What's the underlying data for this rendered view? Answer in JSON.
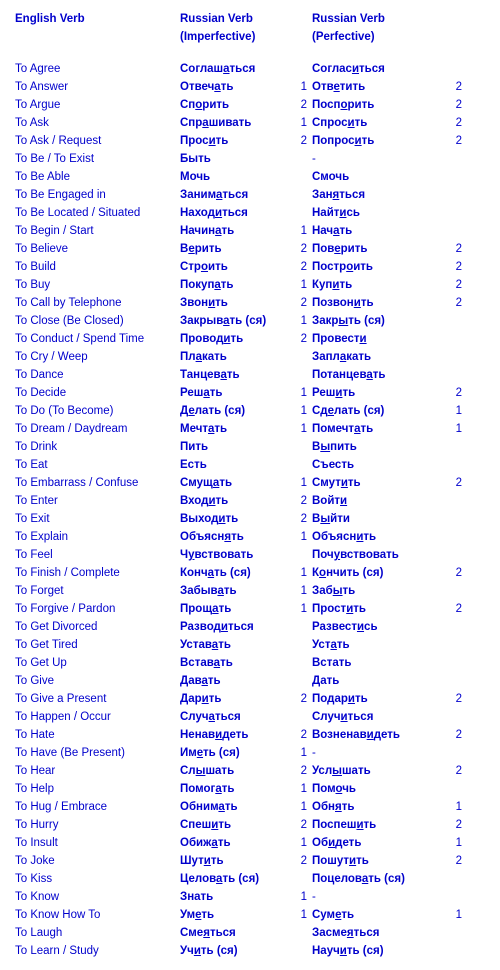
{
  "headers": {
    "english": "English Verb",
    "imperfective_line1": "Russian Verb",
    "imperfective_line2": "(Imperfective)",
    "perfective_line1": "Russian Verb",
    "perfective_line2": "(Perfective)"
  },
  "rows": [
    {
      "en": "To Agree",
      "imp": "Соглаш<u>а</u>ться",
      "impn": "",
      "perf": "Соглас<u>и</u>ться",
      "perfn": ""
    },
    {
      "en": "To Answer",
      "imp": "Отвеч<u>а</u>ть",
      "impn": "1",
      "perf": "Отв<u>е</u>тить",
      "perfn": "2"
    },
    {
      "en": "To Argue",
      "imp": "Сп<u>о</u>рить",
      "impn": "2",
      "perf": "Посп<u>о</u>рить",
      "perfn": "2"
    },
    {
      "en": "To Ask",
      "imp": "Спр<u>а</u>шивать",
      "impn": "1",
      "perf": "Спрос<u>и</u>ть",
      "perfn": "2"
    },
    {
      "en": "To Ask / Request",
      "imp": "Прос<u>и</u>ть",
      "impn": "2",
      "perf": "Попрос<u>и</u>ть",
      "perfn": "2"
    },
    {
      "en": "To Be / To Exist",
      "imp": "Быть",
      "impn": "",
      "perf": "-",
      "perfn": ""
    },
    {
      "en": "To Be Able",
      "imp": "Мочь",
      "impn": "",
      "perf": "Смочь",
      "perfn": ""
    },
    {
      "en": "To Be Engaged in",
      "imp": "Заним<u>а</u>ться",
      "impn": "",
      "perf": "Зан<u>я</u>ться",
      "perfn": ""
    },
    {
      "en": "To Be Located / Situated",
      "imp": "Наход<u>и</u>ться",
      "impn": "",
      "perf": "Найт<u>и</u>сь",
      "perfn": ""
    },
    {
      "en": "To Begin / Start",
      "imp": "Начин<u>а</u>ть",
      "impn": "1",
      "perf": "Нач<u>а</u>ть",
      "perfn": ""
    },
    {
      "en": "To Believe",
      "imp": "В<u>е</u>рить",
      "impn": "2",
      "perf": "Пов<u>е</u>рить",
      "perfn": "2"
    },
    {
      "en": "To Build",
      "imp": "Стр<u>о</u>ить",
      "impn": "2",
      "perf": "Постр<u>о</u>ить",
      "perfn": "2"
    },
    {
      "en": "To Buy",
      "imp": "Покуп<u>а</u>ть",
      "impn": "1",
      "perf": "Куп<u>и</u>ть",
      "perfn": "2"
    },
    {
      "en": "To Call by Telephone",
      "imp": "Звон<u>и</u>ть",
      "impn": "2",
      "perf": "Позвон<u>и</u>ть",
      "perfn": "2"
    },
    {
      "en": "To Close (Be Closed)",
      "imp": "Закрыв<u>а</u>ть (ся)",
      "impn": "1",
      "perf": "Закр<u>ы</u>ть (ся)",
      "perfn": ""
    },
    {
      "en": "To Conduct / Spend Time",
      "imp": "Провод<u>и</u>ть",
      "impn": "2",
      "perf": "Провест<u>и</u>",
      "perfn": ""
    },
    {
      "en": "To Cry / Weep",
      "imp": "Пл<u>а</u>кать",
      "impn": "",
      "perf": "Запл<u>а</u>кать",
      "perfn": ""
    },
    {
      "en": "To Dance",
      "imp": "Танцев<u>а</u>ть",
      "impn": "",
      "perf": "Потанцев<u>а</u>ть",
      "perfn": ""
    },
    {
      "en": "To Decide",
      "imp": "Реш<u>а</u>ть",
      "impn": "1",
      "perf": "Реш<u>и</u>ть",
      "perfn": "2"
    },
    {
      "en": "To Do (To Become)",
      "imp": "Д<u>е</u>лать (ся)",
      "impn": "1",
      "perf": "Сд<u>е</u>лать (ся)",
      "perfn": "1"
    },
    {
      "en": "To Dream / Daydream",
      "imp": "Мечт<u>а</u>ть",
      "impn": "1",
      "perf": "Помечт<u>а</u>ть",
      "perfn": "1"
    },
    {
      "en": "To Drink",
      "imp": "Пить",
      "impn": "",
      "perf": "В<u>ы</u>пить",
      "perfn": ""
    },
    {
      "en": "To Eat",
      "imp": "Есть",
      "impn": "",
      "perf": "Съесть",
      "perfn": ""
    },
    {
      "en": "To Embarrass / Confuse",
      "imp": "Смущ<u>а</u>ть",
      "impn": "1",
      "perf": "Смут<u>и</u>ть",
      "perfn": "2"
    },
    {
      "en": "To Enter",
      "imp": "Вход<u>и</u>ть",
      "impn": "2",
      "perf": "Войт<u>и</u>",
      "perfn": ""
    },
    {
      "en": "To Exit",
      "imp": "Выход<u>и</u>ть",
      "impn": "2",
      "perf": "В<u>ы</u>йти",
      "perfn": ""
    },
    {
      "en": "To Explain",
      "imp": "Объясн<u>я</u>ть",
      "impn": "1",
      "perf": "Объясн<u>и</u>ть",
      "perfn": ""
    },
    {
      "en": "To Feel",
      "imp": "Ч<u>у</u>вствовать",
      "impn": "",
      "perf": "Поч<u>у</u>вствовать",
      "perfn": ""
    },
    {
      "en": "To Finish / Complete",
      "imp": "Конч<u>а</u>ть (ся)",
      "impn": "1",
      "perf": "К<u>о</u>нчить (ся)",
      "perfn": "2"
    },
    {
      "en": "To Forget",
      "imp": "Забыв<u>а</u>ть",
      "impn": "1",
      "perf": "Заб<u>ы</u>ть",
      "perfn": ""
    },
    {
      "en": "To Forgive / Pardon",
      "imp": "Прощ<u>а</u>ть",
      "impn": "1",
      "perf": "Прост<u>и</u>ть",
      "perfn": "2"
    },
    {
      "en": "To Get Divorced",
      "imp": "Развод<u>и</u>ться",
      "impn": "",
      "perf": "Развест<u>и</u>сь",
      "perfn": ""
    },
    {
      "en": "To Get Tired",
      "imp": "Устав<u>а</u>ть",
      "impn": "",
      "perf": "Уст<u>а</u>ть",
      "perfn": ""
    },
    {
      "en": "To Get Up",
      "imp": "Встав<u>а</u>ть",
      "impn": "",
      "perf": "Встать",
      "perfn": ""
    },
    {
      "en": "To Give",
      "imp": "Дав<u>а</u>ть",
      "impn": "",
      "perf": "Дать",
      "perfn": ""
    },
    {
      "en": "To Give a Present",
      "imp": "Дар<u>и</u>ть",
      "impn": "2",
      "perf": "Подар<u>и</u>ть",
      "perfn": "2"
    },
    {
      "en": "To Happen / Occur",
      "imp": "Случ<u>а</u>ться",
      "impn": "",
      "perf": "Случ<u>и</u>ться",
      "perfn": ""
    },
    {
      "en": "To Hate",
      "imp": "Ненав<u>и</u>деть",
      "impn": "2",
      "perf": "Возненав<u>и</u>деть",
      "perfn": "2"
    },
    {
      "en": "To Have (Be Present)",
      "imp": "Им<u>е</u>ть (ся)",
      "impn": "1",
      "perf": "-",
      "perfn": ""
    },
    {
      "en": "To Hear",
      "imp": "Сл<u>ы</u>шать",
      "impn": "2",
      "perf": "Усл<u>ы</u>шать",
      "perfn": "2"
    },
    {
      "en": "To Help",
      "imp": "Помог<u>а</u>ть",
      "impn": "1",
      "perf": "Пом<u>о</u>чь",
      "perfn": ""
    },
    {
      "en": "To Hug / Embrace",
      "imp": "Обним<u>а</u>ть",
      "impn": "1",
      "perf": "Обн<u>я</u>ть",
      "perfn": "1"
    },
    {
      "en": "To Hurry",
      "imp": "Спеш<u>и</u>ть",
      "impn": "2",
      "perf": "Поспеш<u>и</u>ть",
      "perfn": "2"
    },
    {
      "en": "To Insult",
      "imp": "Обиж<u>а</u>ть",
      "impn": "1",
      "perf": "Об<u>и</u>деть",
      "perfn": "1"
    },
    {
      "en": "To Joke",
      "imp": "Шут<u>и</u>ть",
      "impn": "2",
      "perf": "Пошут<u>и</u>ть",
      "perfn": "2"
    },
    {
      "en": "To Kiss",
      "imp": "Целов<u>а</u>ть (ся)",
      "impn": "",
      "perf": "Поцелов<u>а</u>ть (ся)",
      "perfn": ""
    },
    {
      "en": "To Know",
      "imp": "Знать",
      "impn": "1",
      "perf": "-",
      "perfn": ""
    },
    {
      "en": "To Know How To",
      "imp": "Ум<u>е</u>ть",
      "impn": "1",
      "perf": "Сум<u>е</u>ть",
      "perfn": "1"
    },
    {
      "en": "To Laugh",
      "imp": "Сме<u>я</u>ться",
      "impn": "",
      "perf": "Засме<u>я</u>ться",
      "perfn": ""
    },
    {
      "en": "To Learn / Study",
      "imp": "Уч<u>и</u>ть (ся)",
      "impn": "",
      "perf": "Науч<u>и</u>ть (ся)",
      "perfn": ""
    }
  ]
}
